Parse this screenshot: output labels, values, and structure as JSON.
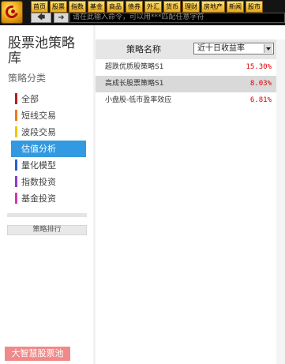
{
  "toolbar": {
    "tabs": [
      "首页",
      "股票",
      "指数",
      "基金",
      "商品",
      "债券",
      "外汇",
      "货币",
      "理财",
      "房地产",
      "新闻",
      "股市"
    ],
    "back_icon": "back-arrow-icon",
    "forward_icon": "forward-arrow-icon",
    "command_placeholder": "请在此输入命令，可以用***匹配任意字符"
  },
  "sidebar": {
    "title": "股票池策略库",
    "category_heading": "策略分类",
    "categories": [
      {
        "label": "全部",
        "color": "#b02020"
      },
      {
        "label": "短线交易",
        "color": "#f07a1a"
      },
      {
        "label": "波段交易",
        "color": "#f2c400"
      },
      {
        "label": "估值分析",
        "color": "#3399e0",
        "active": true
      },
      {
        "label": "量化模型",
        "color": "#2a5fd0"
      },
      {
        "label": "指数投资",
        "color": "#8a3ec8"
      },
      {
        "label": "基金投资",
        "color": "#d03aa8"
      }
    ],
    "rank_button": "策略排行",
    "brand_badge": "大智慧股票池"
  },
  "table": {
    "col_name": "策略名称",
    "sort_select": "近十日收益率",
    "rows": [
      {
        "name": "超跌优质股策略S1",
        "value": "15.30%"
      },
      {
        "name": "高成长股票策略S1",
        "value": "8.03%"
      },
      {
        "name": "小盘股-低市盈率效应",
        "value": "6.81%"
      }
    ]
  }
}
